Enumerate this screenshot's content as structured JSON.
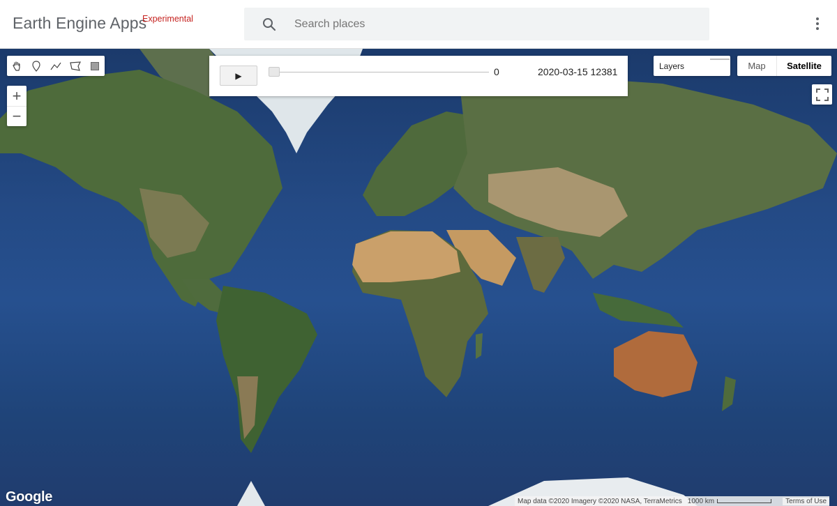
{
  "header": {
    "brand": "Earth Engine Apps",
    "brand_tag": "Experimental",
    "search_placeholder": "Search places",
    "menu_icon": "more-vert-icon"
  },
  "map": {
    "draw_tools": [
      {
        "name": "hand-pan-icon"
      },
      {
        "name": "point-marker-icon"
      },
      {
        "name": "line-icon"
      },
      {
        "name": "polygon-icon"
      },
      {
        "name": "rectangle-icon"
      }
    ],
    "zoom_in": "+",
    "zoom_out": "−",
    "timeline": {
      "play_label": "▶",
      "slider_value": "0",
      "slider_fraction": 0,
      "date_label": "2020-03-15 12381"
    },
    "layers_label": "Layers",
    "map_type": {
      "map_label": "Map",
      "satellite_label": "Satellite",
      "selected": "Satellite"
    },
    "google_logo": "Google",
    "attribution": "Map data ©2020 Imagery ©2020 NASA, TerraMetrics",
    "scale_label": "1000 km",
    "terms": "Terms of Use"
  },
  "colors": {
    "brand_tag": "#c5221f",
    "ocean": "#244a85",
    "land_green": "#4d6a3a",
    "desert": "#c9a36a",
    "ice": "#e9edf1"
  }
}
